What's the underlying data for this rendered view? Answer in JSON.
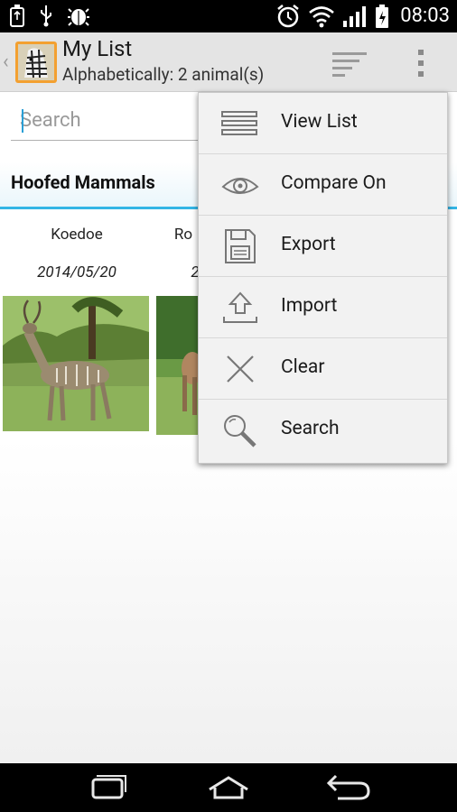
{
  "status_bar": {
    "time": "08:03",
    "left_icons": [
      "usb-storage-icon",
      "usb-icon",
      "android-debug-icon"
    ],
    "right_icons": [
      "alarm-icon",
      "wifi-icon",
      "signal-icon",
      "battery-charging-icon"
    ]
  },
  "action_bar": {
    "title": "My List",
    "subtitle": "Alphabetically: 2 animal(s)",
    "icons": [
      "up-caret-icon",
      "zebra-app-icon",
      "sort-icon",
      "overflow-menu-icon"
    ]
  },
  "search": {
    "placeholder": "Search"
  },
  "section": {
    "title": "Hoofed Mammals"
  },
  "cards": [
    {
      "name": "Koedoe",
      "date": "2014/05/20"
    },
    {
      "name": "Ro",
      "date": "2"
    }
  ],
  "menu": {
    "items": [
      {
        "label": "View List",
        "icon": "list-icon"
      },
      {
        "label": "Compare On",
        "icon": "eye-icon"
      },
      {
        "label": "Export",
        "icon": "save-icon"
      },
      {
        "label": "Import",
        "icon": "upload-icon"
      },
      {
        "label": "Clear",
        "icon": "close-icon"
      },
      {
        "label": "Search",
        "icon": "search-icon"
      }
    ]
  },
  "nav_bar": {
    "icons": [
      "recent-apps-icon",
      "home-icon",
      "back-icon"
    ]
  },
  "colors": {
    "accent": "#33b5e5",
    "app_icon_bg": "#f3a030",
    "action_bar_bg": "#e4e4e4",
    "menu_bg": "#f2f2f2"
  }
}
